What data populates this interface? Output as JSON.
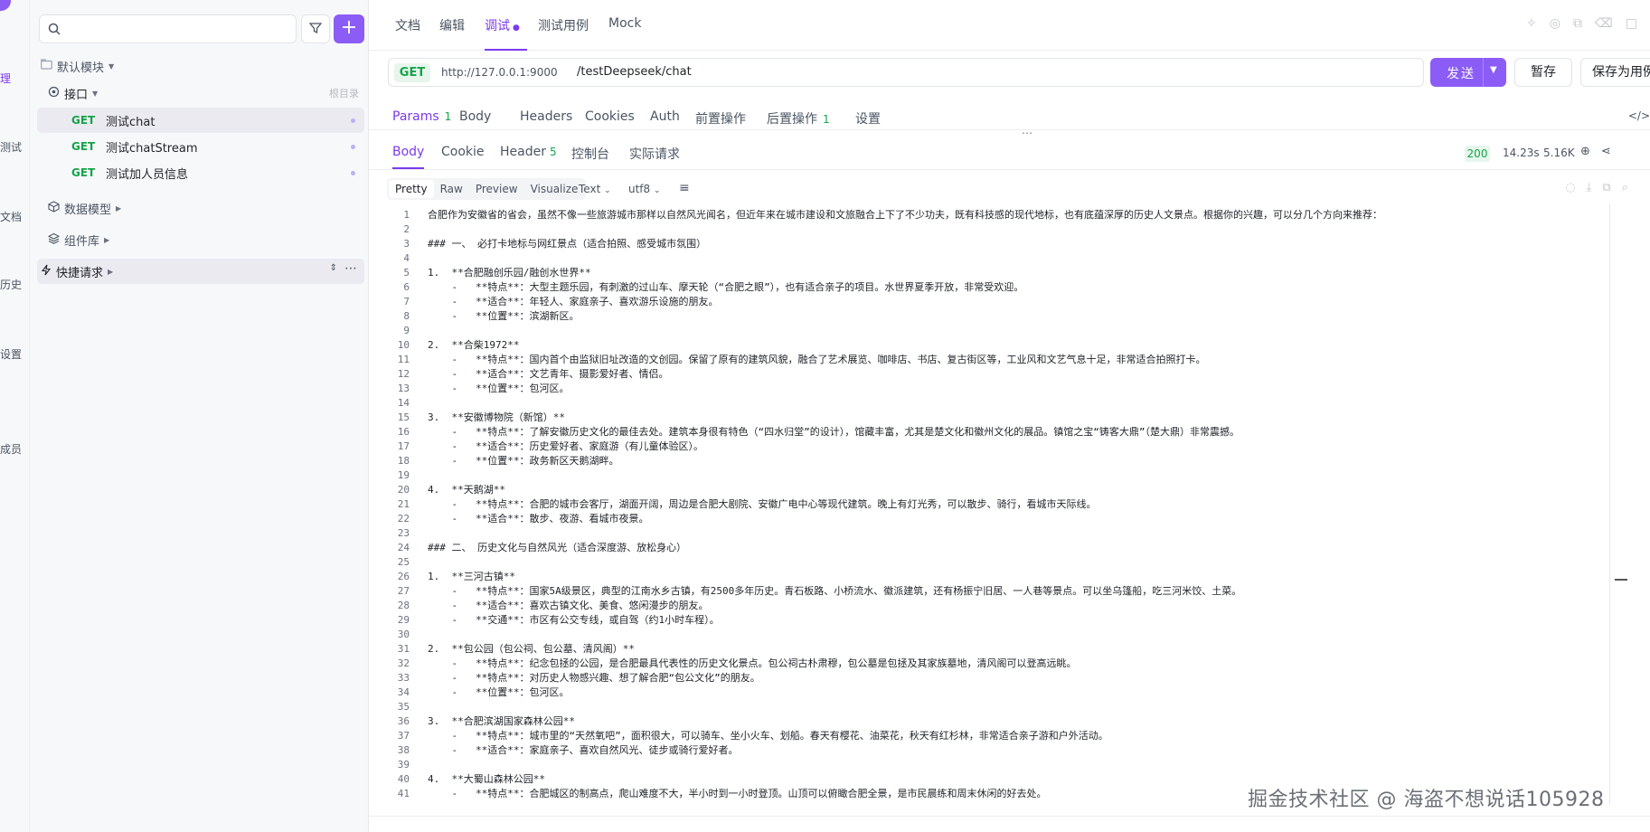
{
  "rail": {
    "items": [
      "理",
      "测试",
      "文档",
      "历史",
      "设置",
      "成员"
    ]
  },
  "sidebar": {
    "search_placeholder": "",
    "add_label": "+",
    "module": "默认模块",
    "group_interface": "接口",
    "group_interface_right": "根目录",
    "endpoints": [
      {
        "method": "GET",
        "name": "测试chat"
      },
      {
        "method": "GET",
        "name": "测试chatStream"
      },
      {
        "method": "GET",
        "name": "测试加人员信息"
      }
    ],
    "data_model": "数据模型",
    "components": "组件库",
    "quick_request": "快捷请求"
  },
  "top_tabs": [
    "文档",
    "编辑",
    "调试",
    "测试用例",
    "Mock"
  ],
  "request": {
    "method": "GET",
    "host": "http://127.0.0.1:9000",
    "path": "/testDeepseek/chat",
    "send_label": "发送",
    "save_label": "暂存",
    "save_as_label": "保存为用例"
  },
  "request_tabs": [
    {
      "label": "Params",
      "count": "1"
    },
    {
      "label": "Body",
      "count": ""
    },
    {
      "label": "Headers",
      "count": ""
    },
    {
      "label": "Cookies",
      "count": ""
    },
    {
      "label": "Auth",
      "count": ""
    },
    {
      "label": "前置操作",
      "count": ""
    },
    {
      "label": "后置操作",
      "count": "1"
    },
    {
      "label": "设置",
      "count": ""
    }
  ],
  "response_tabs": [
    {
      "label": "Body",
      "count": ""
    },
    {
      "label": "Cookie",
      "count": ""
    },
    {
      "label": "Header",
      "count": "5"
    },
    {
      "label": "控制台",
      "count": ""
    },
    {
      "label": "实际请求",
      "count": ""
    }
  ],
  "response_stats": {
    "status": "200",
    "time": "14.23s",
    "size": "5.16K"
  },
  "view": {
    "modes": [
      "Pretty",
      "Raw",
      "Preview",
      "Visualize"
    ],
    "format": "Text",
    "encoding": "utf8"
  },
  "code_lines": [
    "合肥作为安徽省的省会，虽然不像一些旅游城市那样以自然风光闻名，但近年来在城市建设和文旅融合上下了不少功夫，既有科技感的现代地标，也有底蕴深厚的历史人文景点。根据你的兴趣，可以分几个方向来推荐：",
    "",
    "### 一、 必打卡地标与网红景点（适合拍照、感受城市氛围）",
    "",
    "1.  **合肥融创乐园/融创水世界**",
    "    -   **特点**：大型主题乐园，有刺激的过山车、摩天轮（“合肥之眼”），也有适合亲子的项目。水世界夏季开放，非常受欢迎。",
    "    -   **适合**：年轻人、家庭亲子、喜欢游乐设施的朋友。",
    "    -   **位置**：滨湖新区。",
    "",
    "2.  **合柴1972**",
    "    -   **特点**：国内首个由监狱旧址改造的文创园。保留了原有的建筑风貌，融合了艺术展览、咖啡店、书店、复古街区等，工业风和文艺气息十足，非常适合拍照打卡。",
    "    -   **适合**：文艺青年、摄影爱好者、情侣。",
    "    -   **位置**：包河区。",
    "",
    "3.  **安徽博物院（新馆）**",
    "    -   **特点**：了解安徽历史文化的最佳去处。建筑本身很有特色（“四水归堂”的设计），馆藏丰富，尤其是楚文化和徽州文化的展品。镇馆之宝“铸客大鼎”（楚大鼎）非常震撼。",
    "    -   **适合**：历史爱好者、家庭游（有儿童体验区）。",
    "    -   **位置**：政务新区天鹅湖畔。",
    "",
    "4.  **天鹅湖**",
    "    -   **特点**：合肥的城市会客厅，湖面开阔，周边是合肥大剧院、安徽广电中心等现代建筑。晚上有灯光秀，可以散步、骑行，看城市天际线。",
    "    -   **适合**：散步、夜游、看城市夜景。",
    "",
    "### 二、 历史文化与自然风光（适合深度游、放松身心）",
    "",
    "1.  **三河古镇**",
    "    -   **特点**：国家5A级景区，典型的江南水乡古镇，有2500多年历史。青石板路、小桥流水、徽派建筑，还有杨振宁旧居、一人巷等景点。可以坐乌篷船，吃三河米饺、土菜。",
    "    -   **适合**：喜欢古镇文化、美食、悠闲漫步的朋友。",
    "    -   **交通**：市区有公交专线，或自驾（约1小时车程）。",
    "",
    "2.  **包公园（包公祠、包公墓、清风阁）**",
    "    -   **特点**：纪念包拯的公园，是合肥最具代表性的历史文化景点。包公祠古朴肃穆，包公墓是包拯及其家族墓地，清风阁可以登高远眺。",
    "    -   **特点**：对历史人物感兴趣、想了解合肥“包公文化”的朋友。",
    "    -   **位置**：包河区。",
    "",
    "3.  **合肥滨湖国家森林公园**",
    "    -   **特点**：城市里的“天然氧吧”，面积很大，可以骑车、坐小火车、划船。春天有樱花、油菜花，秋天有红杉林，非常适合亲子游和户外活动。",
    "    -   **适合**：家庭亲子、喜欢自然风光、徒步或骑行爱好者。",
    "",
    "4.  **大蜀山森林公园**",
    "    -   **特点**：合肥城区的制高点，爬山难度不大，半小时到一小时登顶。山顶可以俯瞰合肥全景，是市民晨练和周末休闲的好去处。"
  ],
  "watermark": "掘金技术社区 @ 海盗不想说话105928"
}
